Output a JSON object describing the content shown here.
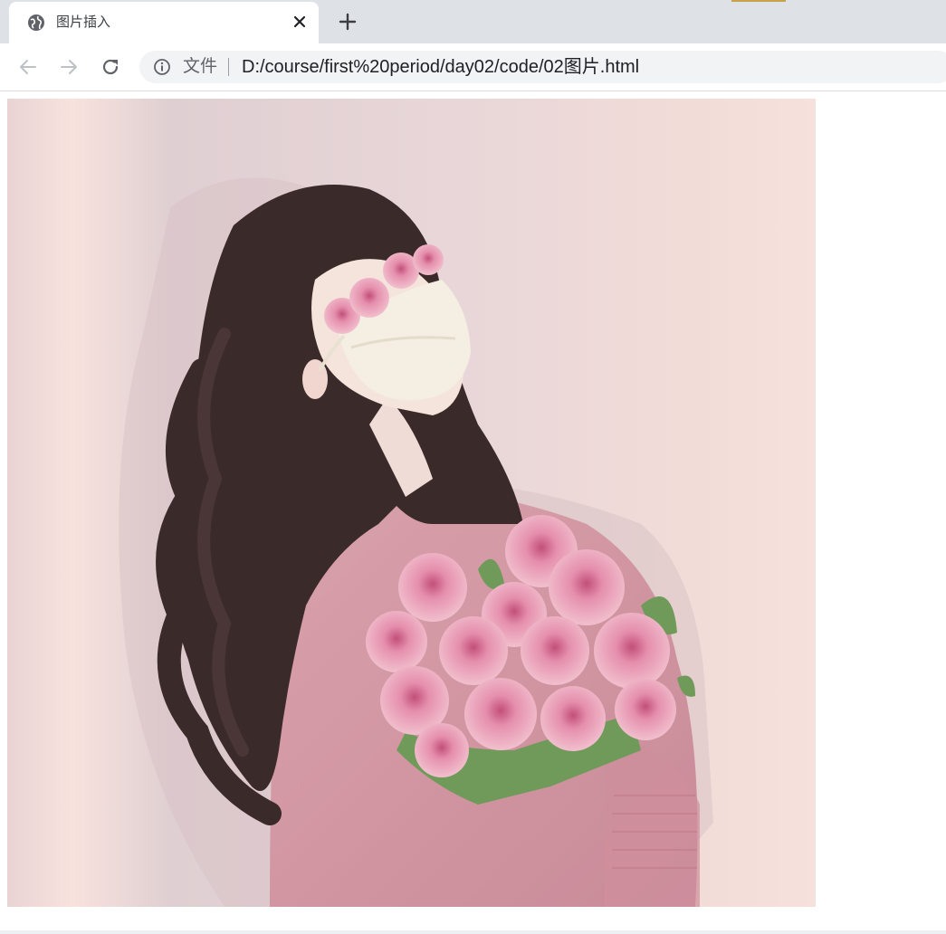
{
  "tab": {
    "title": "图片插入",
    "icon": "globe-icon"
  },
  "omnibox": {
    "security_chip": "文件",
    "url": "D:/course/first%20period/day02/code/02图片.html"
  },
  "page": {
    "image": {
      "alt": "illustration of a girl with long dark hair and a face mask holding a bouquet of pink roses",
      "palette": {
        "background": "#ecd6d6",
        "hair": "#3b2a2a",
        "sweater": "#d79aa5",
        "rose": "#e6a3b8",
        "mask": "#f4efe2",
        "leaf": "#6f9a5a"
      }
    }
  },
  "colors": {
    "tabstrip": "#dee1e6",
    "omnibox": "#f1f3f4"
  }
}
